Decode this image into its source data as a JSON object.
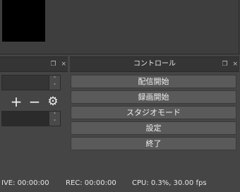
{
  "left_dock": {
    "title": "",
    "float_icon": "❐",
    "close_icon": "×"
  },
  "spin_up": "˄",
  "spin_down": "˅",
  "icons": {
    "add": "+",
    "remove": "−",
    "settings": "⚙"
  },
  "controls_dock": {
    "title": "コントロール",
    "float_icon": "❐",
    "close_icon": "×"
  },
  "controls": [
    {
      "label": "配信開始"
    },
    {
      "label": "録画開始"
    },
    {
      "label": "スタジオモード"
    },
    {
      "label": "設定"
    },
    {
      "label": "終了"
    }
  ],
  "status": {
    "live": "IVE: 00:00:00",
    "rec": "REC: 00:00:00",
    "cpu": "CPU: 0.3%, 30.00 fps"
  }
}
